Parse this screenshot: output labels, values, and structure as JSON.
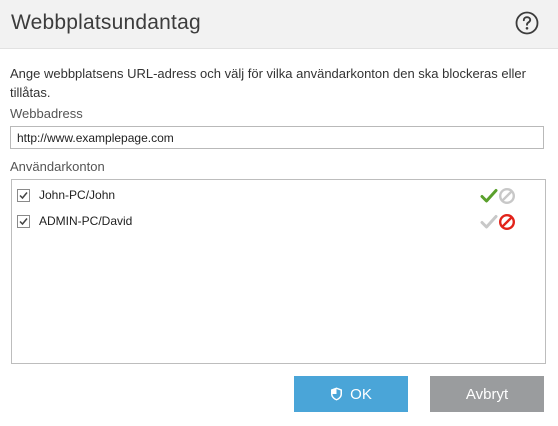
{
  "dialog": {
    "title": "Webbplatsundantag",
    "help_icon": "help-circle-icon"
  },
  "description": "Ange webbplatsens URL-adress och välj för vilka användarkonton den ska blockeras eller tillåtas.",
  "url_field": {
    "label": "Webbadress",
    "value": "http://www.examplepage.com"
  },
  "accounts": {
    "label": "Användarkonton",
    "items": [
      {
        "name": "John-PC/John",
        "checked": true,
        "permission": "allow"
      },
      {
        "name": "ADMIN-PC/David",
        "checked": true,
        "permission": "block"
      }
    ]
  },
  "buttons": {
    "ok_label": "OK",
    "ok_icon": "shield-icon",
    "cancel_label": "Avbryt"
  },
  "colors": {
    "allow_active": "#5aa02c",
    "block_active": "#e2231a",
    "inactive": "#c8c8c8",
    "ok_button": "#4aa5d8",
    "cancel_button": "#9a9c9e"
  }
}
